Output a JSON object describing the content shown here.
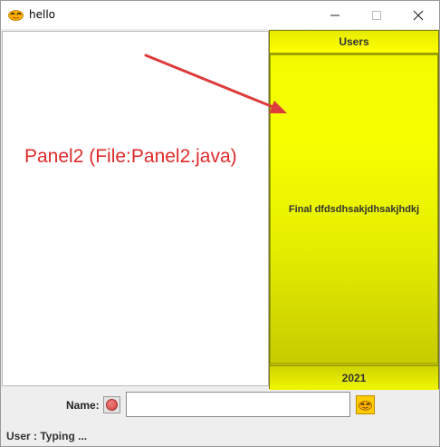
{
  "window": {
    "title": "hello"
  },
  "annotation": {
    "text": "Panel2 (File:Panel2.java)",
    "color": "#e02a2a"
  },
  "users_panel": {
    "header": "Users",
    "message": "Final dfdsdhsakjdhsakjhdkj",
    "footer": "2021",
    "accent_color": "#f6ff00"
  },
  "bottom_bar": {
    "name_label": "Name:",
    "name_value": "",
    "status": "User : Typing ..."
  },
  "icons": {
    "app": "duck-logo-icon",
    "record": "record-icon",
    "send": "duck-logo-icon"
  }
}
